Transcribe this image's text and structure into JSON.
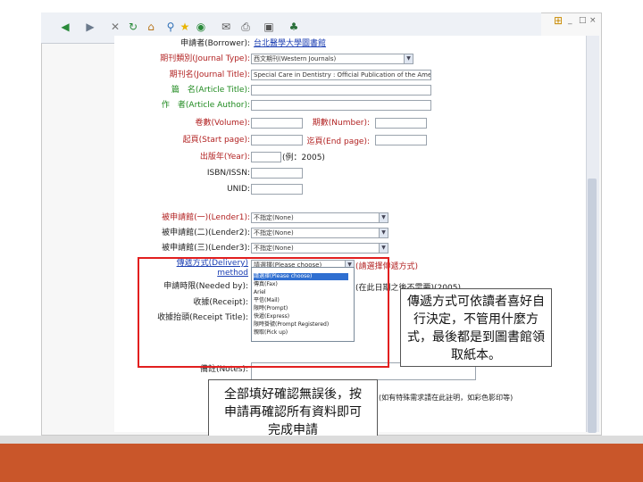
{
  "window": {
    "min": "_",
    "max": "□",
    "close": "×"
  },
  "form": {
    "borrower_label": "申請者(Borrower):",
    "borrower_value": "台北醫學大學圖書館",
    "journal_type_label": "期刊類別(Journal Type):",
    "journal_type_value": "西文期刊(Western Journals)",
    "journal_title_label": "期刊名(Journal Title):",
    "journal_title_value": "Special Care in Dentistry : Official Publication of the Ame",
    "article_title_label": "篇　名(Article Title):",
    "article_author_label": "作　者(Article Author):",
    "volume_label": "卷數(Volume):",
    "number_label": "期數(Number):",
    "start_page_label": "起頁(Start page):",
    "end_page_label": "迄頁(End page):",
    "year_label": "出版年(Year):",
    "year_hint": "(例：2005)",
    "isbn_label": "ISBN/ISSN:",
    "unid_label": "UNID:",
    "lender1_label": "被申請館(一)(Lender1):",
    "lender1_value": "不指定(None)",
    "lender2_label": "被申請館(二)(Lender2):",
    "lender2_value": "不指定(None)",
    "lender3_label": "被申請館(三)(Lender3):",
    "lender3_value": "不指定(None)",
    "delivery_label": "傳遞方式(Delivery)",
    "method_label": "method",
    "delivery_value": "請選擇(Please choose)",
    "delivery_note": "(請選擇傳遞方式)",
    "needed_by_label": "申請時限(Needed by):",
    "needed_by_note": "(在此日期之後不需要)(2005)",
    "receipt_label": "收據(Receipt):",
    "receipt_title_label": "收據抬頭(Receipt Title):",
    "remarks_label": "備註(Notes):",
    "bottom_note": "(如有特殊需求請在此註明，如彩色影印等)"
  },
  "dropdown_options": [
    "請選擇(Please choose)",
    "傳真(Fax)",
    "Ariel",
    "平信(Mail)",
    "限時(Prompt)",
    "快遞(Express)",
    "限時掛號(Prompt Registered)",
    "親取(Pick up)"
  ],
  "callouts": {
    "right": "傳遞方式可依讀者喜好自行決定，不管用什麼方式，最後都是到圖書館領取紙本。",
    "bottom": "全部填好確認無誤後，按申請再確認所有資料即可完成申請"
  }
}
